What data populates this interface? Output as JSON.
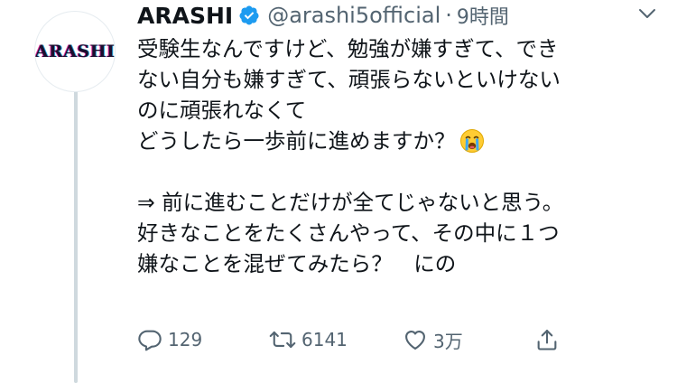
{
  "author": {
    "display_name": "ARASHI",
    "handle": "@arashi5official",
    "separator": "·",
    "time": "9時間",
    "avatar_text": "ARASHI",
    "verified": true
  },
  "tweet": {
    "lines": [
      "受験生なんですけど、勉強が嫌すぎて、でき",
      "ない自分も嫌すぎて、頑張らないといけない",
      "のに頑張れなくて",
      "どうしたら一歩前に進めますか？",
      "",
      "⇒ 前に進むことだけが全てじゃないと思う。",
      "好きなことをたくさんやって、その中に１つ",
      "嫌なことを混ぜてみたら？　にの"
    ],
    "emoji": "loudly-crying-face"
  },
  "actions": {
    "reply_count": "129",
    "retweet_count": "6141",
    "like_count": "3万"
  },
  "colors": {
    "text": "#0f1419",
    "secondary": "#536471",
    "verified": "#1d9bf0",
    "thread_line": "#cfd9de"
  }
}
